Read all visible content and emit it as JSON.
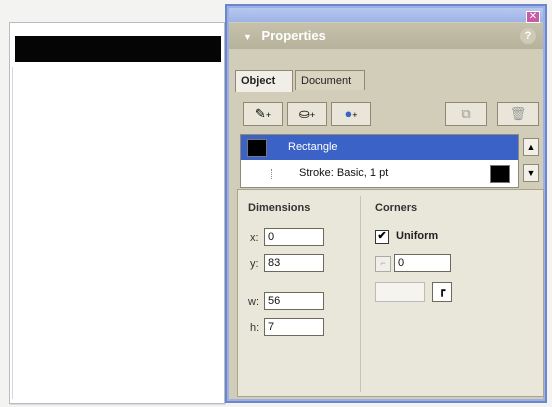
{
  "window": {
    "close_glyph": "✕"
  },
  "panel": {
    "title": "Properties",
    "collapse_icon": "triangle-down-icon",
    "help_glyph": "?"
  },
  "tabs": [
    {
      "label": "Object",
      "active": true
    },
    {
      "label": "Document",
      "active": false
    }
  ],
  "toolbar": {
    "buttons": [
      {
        "icon": "stroke-pen-icon",
        "glyph": "✎",
        "plus": "+"
      },
      {
        "icon": "fill-bucket-icon",
        "glyph": "⛀",
        "plus": "+"
      },
      {
        "icon": "effect-sphere-icon",
        "glyph": "●",
        "plus": "+"
      },
      {
        "icon": "duplicate-icon",
        "glyph": "⧉"
      },
      {
        "icon": "delete-icon",
        "glyph": "🗑"
      }
    ]
  },
  "object_list": {
    "items": [
      {
        "label": "Rectangle",
        "selected": true,
        "swatch_color": "#000000"
      },
      {
        "label": "Stroke: Basic, 1 pt",
        "selected": false,
        "swatch_color": "#000000"
      }
    ],
    "scroll_up": "▲",
    "scroll_down": "▼"
  },
  "dimensions": {
    "title": "Dimensions",
    "x": {
      "label": "x:",
      "value": "0"
    },
    "y": {
      "label": "y:",
      "value": "83"
    },
    "w": {
      "label": "w:",
      "value": "56"
    },
    "h": {
      "label": "h:",
      "value": "7"
    }
  },
  "corners": {
    "title": "Corners",
    "uniform": {
      "label": "Uniform",
      "checked": true,
      "mark": "✔"
    },
    "radius": {
      "value": "0",
      "glyph": "⌐"
    },
    "btn_glyph": "┏"
  },
  "colors": {
    "selection": "#3b63c7",
    "panel_bg": "#d2cdb8",
    "window_border": "#6e86c9"
  }
}
